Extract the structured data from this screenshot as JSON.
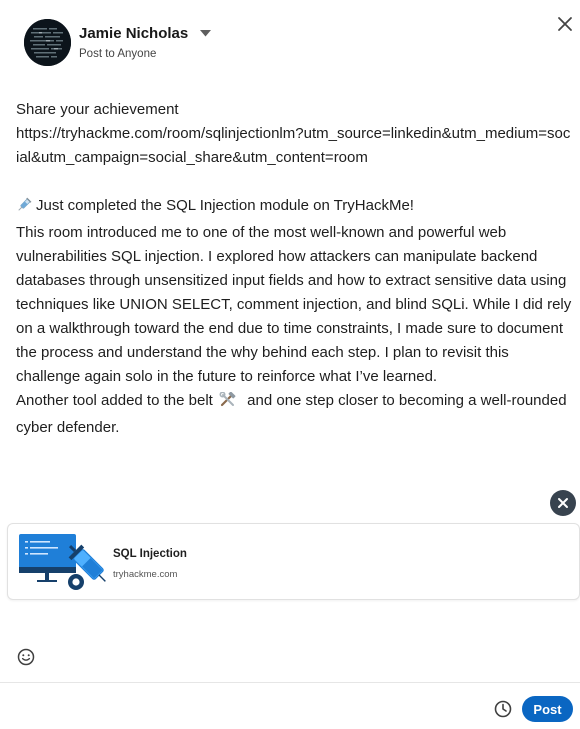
{
  "author": {
    "name": "Jamie Nicholas",
    "visibility": "Post to Anyone"
  },
  "post": {
    "line1": "Share your achievement",
    "url": "https://tryhackme.com/room/sqlinjectionlm?utm_source=linkedin&utm_medium=social&utm_campaign=social_share&utm_content=room",
    "headline": "Just completed the SQL Injection module on TryHackMe!",
    "paragraph": "This room introduced me to one of the most well-known and powerful web vulnerabilities SQL injection. I explored how attackers can manipulate backend databases through unsensitized input fields and how to extract sensitive data using techniques like UNION SELECT, comment injection, and blind SQLi. While I did rely on a walkthrough toward the end due to time constraints, I made sure to document the process and understand the why behind each step. I plan to revisit this challenge again solo in the future to reinforce what I’ve learned.",
    "closing_before": "Another tool added to the belt",
    "closing_after": "and one step closer to becoming a well-rounded cyber defender."
  },
  "link_preview": {
    "title": "SQL Injection",
    "domain": "tryhackme.com"
  },
  "actions": {
    "post_label": "Post"
  },
  "colors": {
    "accent": "#0a66c2",
    "remove_button": "#38434f"
  }
}
